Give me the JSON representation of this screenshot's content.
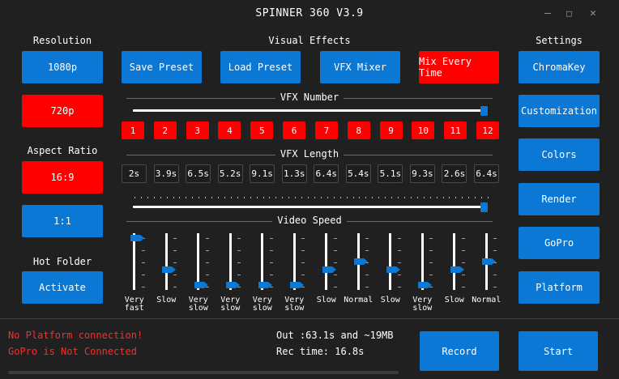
{
  "window": {
    "title": "SPINNER 360 V3.9",
    "minimize_icon": "minimize-icon",
    "maximize_icon": "maximize-icon",
    "close_icon": "close-icon"
  },
  "left": {
    "resolution_label": "Resolution",
    "res_1080": "1080p",
    "res_720": "720p",
    "aspect_label": "Aspect Ratio",
    "aspect_169": "16:9",
    "aspect_11": "1:1",
    "hot_folder_label": "Hot Folder",
    "activate": "Activate"
  },
  "visual_effects": {
    "label": "Visual Effects",
    "save_preset": "Save Preset",
    "load_preset": "Load Preset",
    "vfx_mixer": "VFX Mixer",
    "mix_every_time": "Mix Every Time"
  },
  "vfx_number": {
    "label": "VFX Number",
    "slider_value_fraction": 1.0,
    "numbers": [
      "1",
      "2",
      "3",
      "4",
      "5",
      "6",
      "7",
      "8",
      "9",
      "10",
      "11",
      "12"
    ]
  },
  "vfx_length": {
    "label": "VFX Length",
    "values": [
      "2s",
      "3.9s",
      "6.5s",
      "5.2s",
      "9.1s",
      "1.3s",
      "6.4s",
      "5.4s",
      "5.1s",
      "9.3s",
      "2.6s",
      "6.4s"
    ],
    "slider_value_fraction": 1.0
  },
  "video_speed": {
    "label": "Video Speed",
    "sliders": [
      {
        "label": "Very\nfast",
        "level": 1.0
      },
      {
        "label": "Slow",
        "level": 0.33
      },
      {
        "label": "Very\nslow",
        "level": 0.0
      },
      {
        "label": "Very\nslow",
        "level": 0.0
      },
      {
        "label": "Very\nslow",
        "level": 0.0
      },
      {
        "label": "Very\nslow",
        "level": 0.0
      },
      {
        "label": "Slow",
        "level": 0.33
      },
      {
        "label": "Normal",
        "level": 0.5
      },
      {
        "label": "Slow",
        "level": 0.33
      },
      {
        "label": "Very\nslow",
        "level": 0.0
      },
      {
        "label": "Slow",
        "level": 0.33
      },
      {
        "label": "Normal",
        "level": 0.5
      }
    ]
  },
  "settings": {
    "label": "Settings",
    "chromakey": "ChromaKey",
    "customization": "Customization",
    "colors": "Colors",
    "render": "Render",
    "gopro": "GoPro",
    "platform": "Platform"
  },
  "footer": {
    "status_platform": "No Platform connection!",
    "status_gopro": "GoPro is Not Connected",
    "out_info": "Out :63.1s and ~19MB",
    "rec_time": "Rec time: 16.8s",
    "record": "Record",
    "start": "Start"
  },
  "colors": {
    "background": "#202020",
    "blue": "#0a78d4",
    "red": "#ff0000",
    "status_red": "#ff2a2a"
  }
}
